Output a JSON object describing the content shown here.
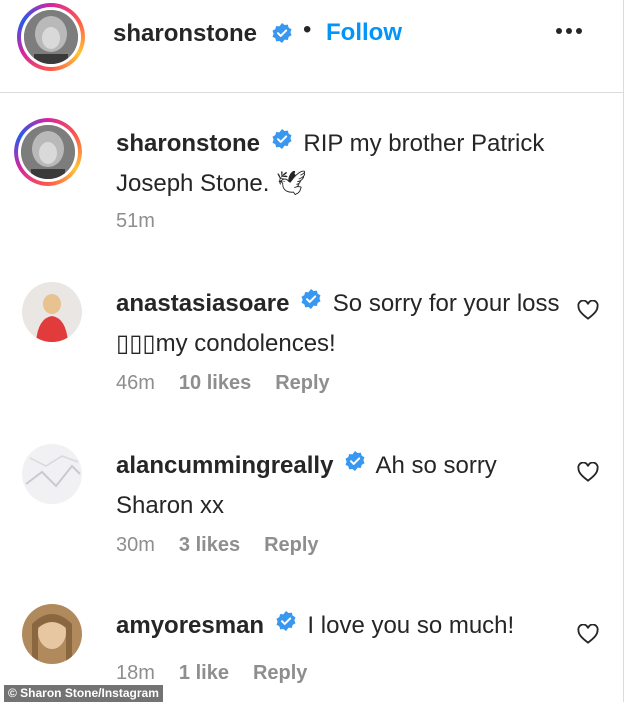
{
  "post": {
    "author": "sharonstone",
    "follow_label": "Follow",
    "dot": "•"
  },
  "comments": [
    {
      "username": "sharonstone",
      "text": "RIP my brother Patrick Joseph Stone. 🕊",
      "time": "51m",
      "likes": "",
      "reply": ""
    },
    {
      "username": "anastasiasoare",
      "text": "So sorry for your loss ▯▯▯my condolences!",
      "time": "46m",
      "likes": "10 likes",
      "reply": "Reply"
    },
    {
      "username": "alancummingreally",
      "text": "Ah so sorry Sharon xx",
      "time": "30m",
      "likes": "3 likes",
      "reply": "Reply"
    },
    {
      "username": "amyoresman",
      "text": "I love you so much!",
      "time": "18m",
      "likes": "1 like",
      "reply": "Reply"
    }
  ],
  "credit": "© Sharon Stone/Instagram",
  "colors": {
    "accent": "#0095f6",
    "verified": "#3897f0",
    "meta": "#8e8e8e"
  },
  "icons": [
    "verified-badge-icon",
    "more-options-icon",
    "heart-icon"
  ]
}
